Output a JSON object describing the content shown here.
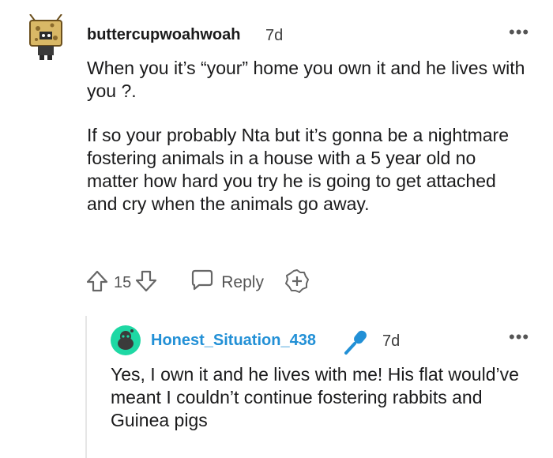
{
  "comment": {
    "username": "buttercupwoahwoah",
    "timestamp": "7d",
    "more_label": "•••",
    "paragraph_1": "When you it’s “your” home you own it and he lives with you ?.",
    "paragraph_2": "If so your probably Nta but it’s gonna be a nightmare fostering animals in a house with a 5 year old no matter how hard you try he is going to get attached and cry when the animals go away.",
    "vote_count": "15",
    "reply_label": "Reply",
    "icons": [
      "upvote-icon",
      "downvote-icon",
      "reply-bubble-icon",
      "award-plus-icon"
    ]
  },
  "reply": {
    "username": "Honest_Situation_438",
    "timestamp": "7d",
    "more_label": "•••",
    "text": "Yes, I own it and he lives with me! His flat would’ve meant I couldn’t continue fostering rabbits and Guinea pigs",
    "icons": [
      "snoo-avatar-icon",
      "microphone-icon"
    ]
  },
  "colors": {
    "reply_username": "#2290d6",
    "avatar_green": "#1ed8a4",
    "text": "#1a1a1b",
    "muted": "#555555"
  }
}
